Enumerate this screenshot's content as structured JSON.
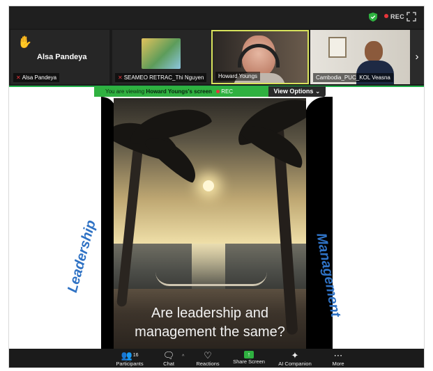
{
  "topbar": {
    "rec_label": "REC"
  },
  "participants_strip": {
    "tiles": [
      {
        "name": "Alsa Pandeya",
        "big_name": "Alsa Pandeya",
        "hand_raised": true,
        "muted": true
      },
      {
        "name": "SEAMEO RETRAC_Thi Nguyen",
        "muted": true
      },
      {
        "name": "Howard Youngs",
        "active_speaker": true
      },
      {
        "name": "Cambodia_PUC_KOL Veasna"
      }
    ],
    "next_icon": "chevron-right-icon"
  },
  "share_banner": {
    "prefix": "You are viewing",
    "owner": "Howard Youngs's screen",
    "rec_label": "REC",
    "view_options": "View Options ⌄"
  },
  "slide": {
    "left_word": "Leadership",
    "right_word": "Management",
    "question_line1": "Are leadership and",
    "question_line2": "management the same?"
  },
  "toolbar": {
    "participants_label": "Participants",
    "participants_count": "16",
    "chat_label": "Chat",
    "reactions_label": "Reactions",
    "share_label": "Share Screen",
    "ai_label": "AI Companion",
    "more_label": "More"
  },
  "colors": {
    "accent_green": "#2fb140",
    "rec_red": "#e8353b",
    "slide_blue": "#2f72c4",
    "speaker_border": "#d8e35c"
  }
}
